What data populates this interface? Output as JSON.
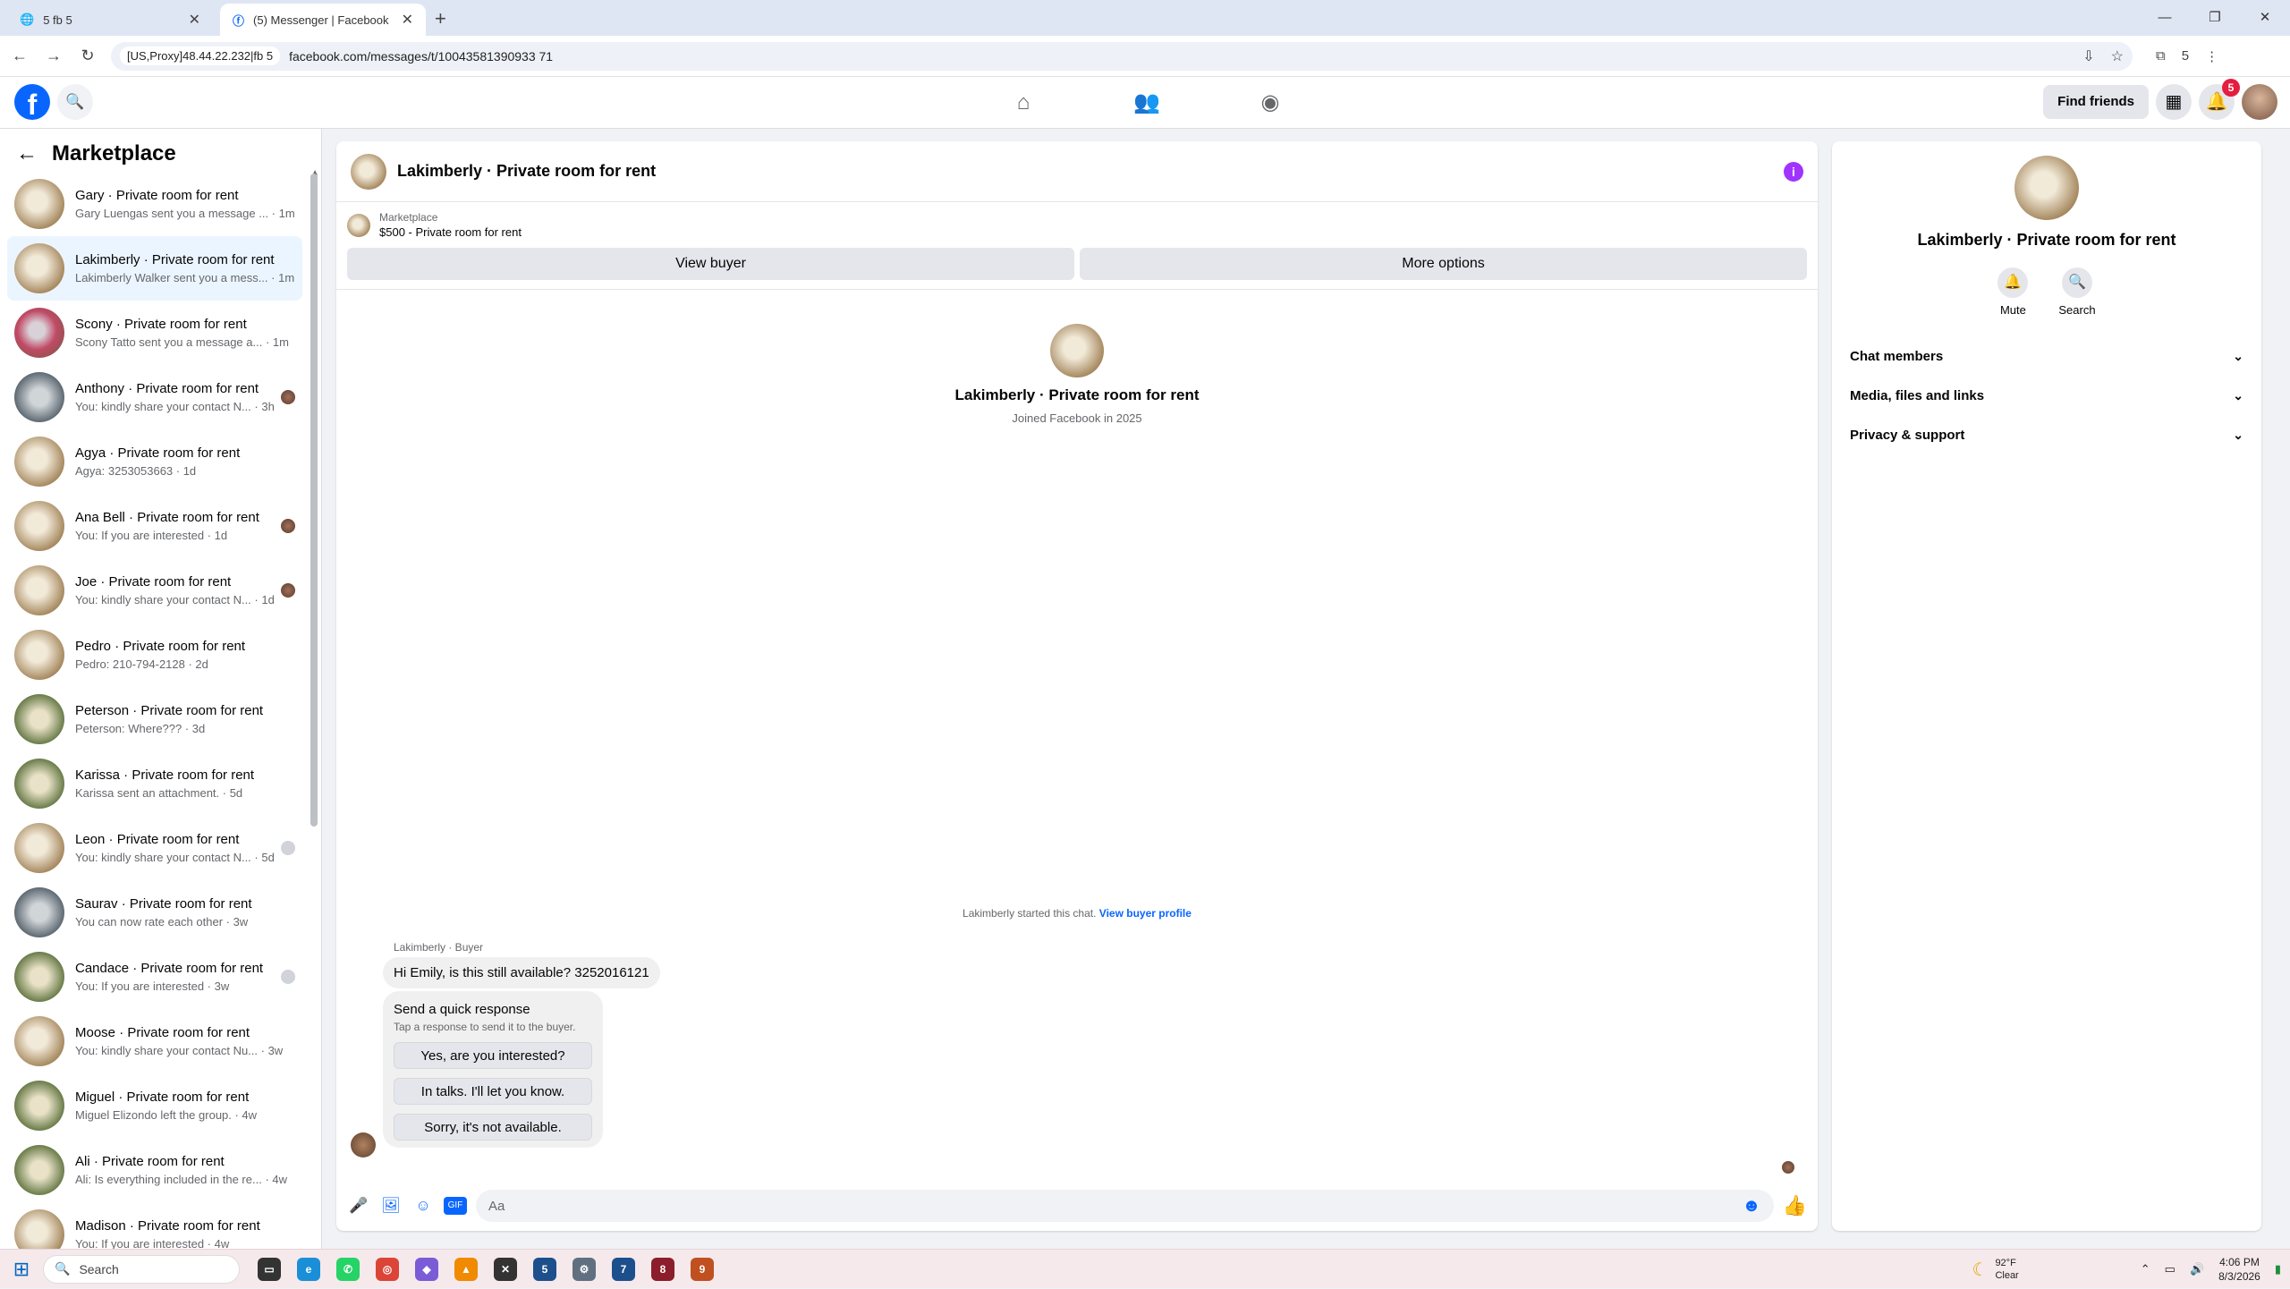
{
  "browser": {
    "tabs": [
      {
        "title": "5 fb 5",
        "active": false
      },
      {
        "title": "(5) Messenger | Facebook",
        "active": true
      }
    ],
    "proxy": "[US,Proxy]48.44.22.232|fb 5",
    "url": "facebook.com/messages/t/10043581390933 71",
    "profile_num": "5"
  },
  "fb": {
    "find_friends": "Find friends",
    "notif_count": "5"
  },
  "sidebar": {
    "title": "Marketplace",
    "conversations": [
      {
        "name": "Gary · Private room for rent",
        "preview": "Gary Luengas sent you a message ... · 1m"
      },
      {
        "name": "Lakimberly · Private room for rent",
        "preview": "Lakimberly Walker sent you a mess... · 1m"
      },
      {
        "name": "Scony · Private room for rent",
        "preview": "Scony Tatto sent you a message a... · 1m"
      },
      {
        "name": "Anthony · Private room for rent",
        "preview": "You: kindly share your contact N... · 3h"
      },
      {
        "name": "Agya · Private room for rent",
        "preview": "Agya: 3253053663 · 1d"
      },
      {
        "name": "Ana Bell · Private room for rent",
        "preview": "You: If you are interested · 1d"
      },
      {
        "name": "Joe · Private room for rent",
        "preview": "You: kindly share your contact N... · 1d"
      },
      {
        "name": "Pedro · Private room for rent",
        "preview": "Pedro: 210-794-2128 · 2d"
      },
      {
        "name": "Peterson · Private room for rent",
        "preview": "Peterson: Where??? · 3d"
      },
      {
        "name": "Karissa · Private room for rent",
        "preview": "Karissa sent an attachment. · 5d"
      },
      {
        "name": "Leon · Private room for rent",
        "preview": "You: kindly share your contact N... · 5d"
      },
      {
        "name": "Saurav · Private room for rent",
        "preview": "You can now rate each other · 3w"
      },
      {
        "name": "Candace · Private room for rent",
        "preview": "You: If you are interested · 3w"
      },
      {
        "name": "Moose · Private room for rent",
        "preview": "You: kindly share your contact Nu... · 3w"
      },
      {
        "name": "Miguel · Private room for rent",
        "preview": "Miguel Elizondo left the group. · 4w"
      },
      {
        "name": "Ali · Private room for rent",
        "preview": "Ali: Is everything included in the re... · 4w"
      },
      {
        "name": "Madison · Private room for rent",
        "preview": "You: If you are interested · 4w"
      }
    ]
  },
  "chat": {
    "title": "Lakimberly · Private room for rent",
    "listing_source": "Marketplace",
    "listing_name": "$500 - Private room for rent",
    "view_buyer": "View buyer",
    "more_options": "More options",
    "profile_name": "Lakimberly · Private room for rent",
    "joined": "Joined Facebook in 2025",
    "started_text": "Lakimberly started this chat.",
    "started_link": "View buyer profile",
    "sender_label": "Lakimberly · Buyer",
    "message": "Hi Emily, is this still available? 3252016121",
    "quick_title": "Send a quick response",
    "quick_sub": "Tap a response to send it to the buyer.",
    "quick_responses": [
      "Yes, are you interested?",
      "In talks. I'll let you know.",
      "Sorry, it's not available."
    ],
    "input_placeholder": "Aa"
  },
  "panel": {
    "name": "Lakimberly · Private room for rent",
    "mute": "Mute",
    "search": "Search",
    "sections": [
      "Chat members",
      "Media, files and links",
      "Privacy & support"
    ]
  },
  "taskbar": {
    "search": "Search",
    "temp": "92°F",
    "cond": "Clear",
    "time": "4:06 PM",
    "date": "8/3/2026"
  }
}
